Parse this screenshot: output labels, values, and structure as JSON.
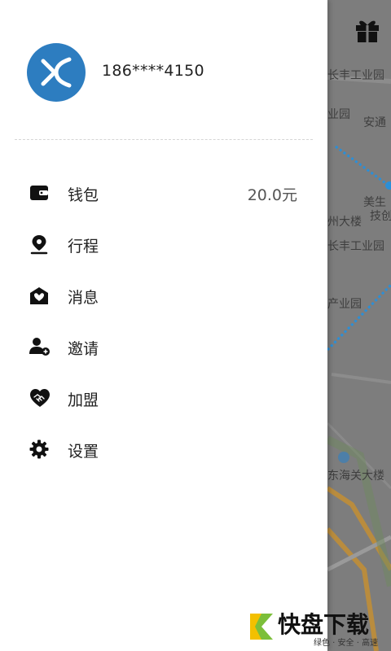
{
  "user": {
    "phone": "186****4150"
  },
  "menu": [
    {
      "label": "钱包",
      "value": "20.0元"
    },
    {
      "label": "行程"
    },
    {
      "label": "消息"
    },
    {
      "label": "邀请"
    },
    {
      "label": "加盟"
    },
    {
      "label": "设置"
    }
  ],
  "map_labels": [
    "长丰工业园",
    "业园",
    "安通",
    "美生",
    "技创",
    "州大楼",
    "长丰工业园",
    "产业园",
    "东海关大楼"
  ],
  "watermark": {
    "title": "快盘下载",
    "subtitle": "绿色 · 安全 · 高速"
  },
  "colors": {
    "avatar": "#2d7dc0",
    "route": "#2a8fd8",
    "road": "#c8902e"
  }
}
